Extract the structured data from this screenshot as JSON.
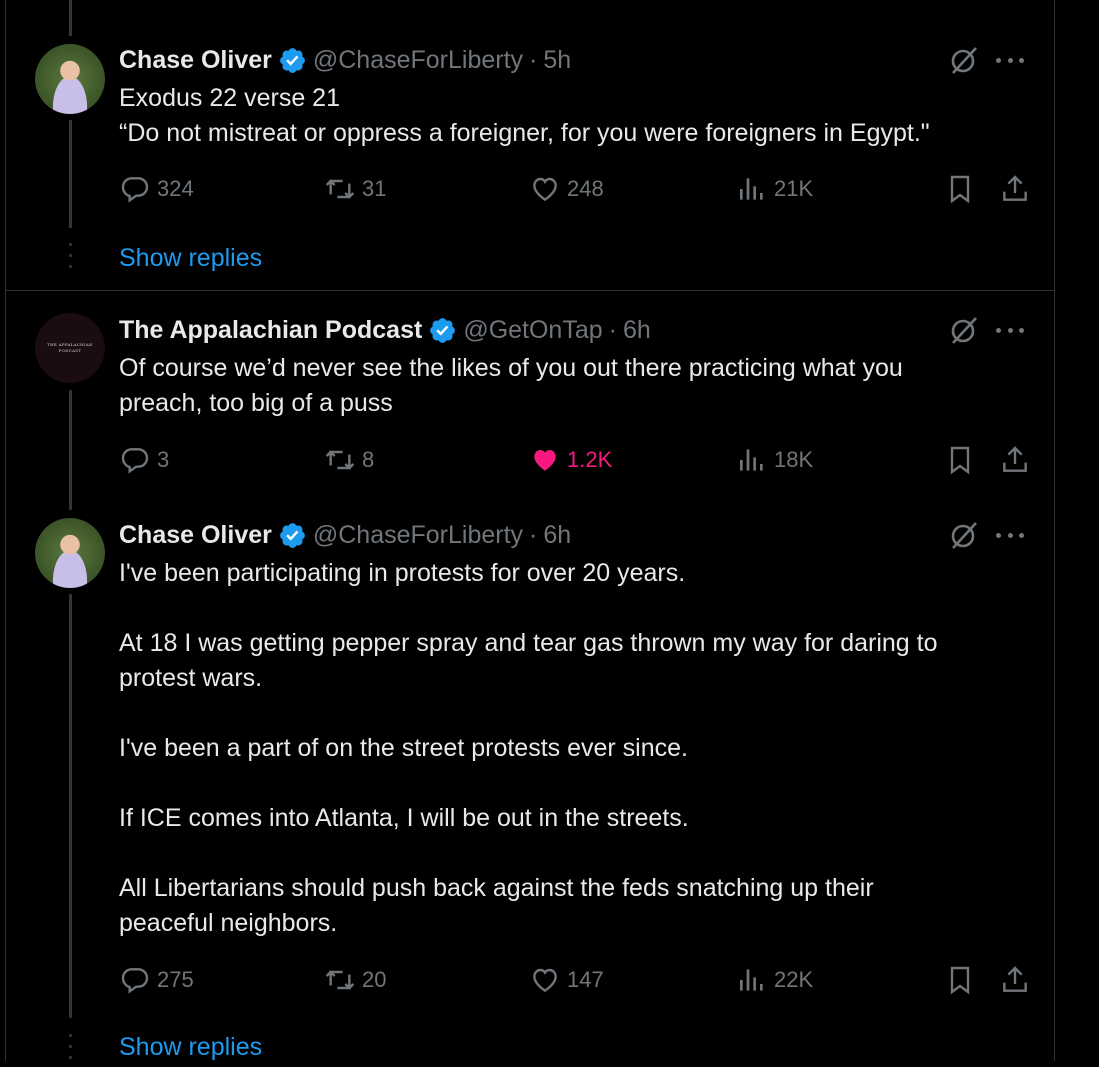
{
  "tweets": [
    {
      "name": "Chase Oliver",
      "handle": "@ChaseForLiberty",
      "time": "5h",
      "text": "Exodus 22 verse 21\n“Do not mistreat or oppress a foreigner, for you were foreigners in Egypt.\"",
      "replies": "324",
      "reposts": "31",
      "likes": "248",
      "views": "21K"
    },
    {
      "name": "The Appalachian Podcast",
      "handle": "@GetOnTap",
      "time": "6h",
      "text": "Of course we’d never see the likes of you out there practicing what you\npreach, too big of a puss",
      "replies": "3",
      "reposts": "8",
      "likes": "1.2K",
      "views": "18K",
      "avatar_text": [
        "THE APPALACHIAN",
        "PODCAST"
      ]
    },
    {
      "name": "Chase Oliver",
      "handle": "@ChaseForLiberty",
      "time": "6h",
      "text": "I've been participating in protests for over 20 years.\n\nAt 18 I was getting pepper spray and tear gas thrown my way for daring to\nprotest wars.\n\nI've been a part of on the street protests ever since.\n\nIf ICE comes into Atlanta, I will be out in the streets.\n\nAll Libertarians should push back against the feds snatching up their\npeaceful neighbors.",
      "replies": "275",
      "reposts": "20",
      "likes": "147",
      "views": "22K"
    }
  ],
  "show_replies_label": "Show replies",
  "separator": "·",
  "colors": {
    "accent": "#1d9bf0",
    "like": "#f91880",
    "muted": "#71767b",
    "text": "#e7e9ea",
    "border": "#2f3336"
  },
  "icons": [
    "verified-badge-icon",
    "grok-icon",
    "more-icon",
    "reply-icon",
    "repost-icon",
    "like-icon",
    "views-icon",
    "bookmark-icon",
    "share-icon"
  ]
}
